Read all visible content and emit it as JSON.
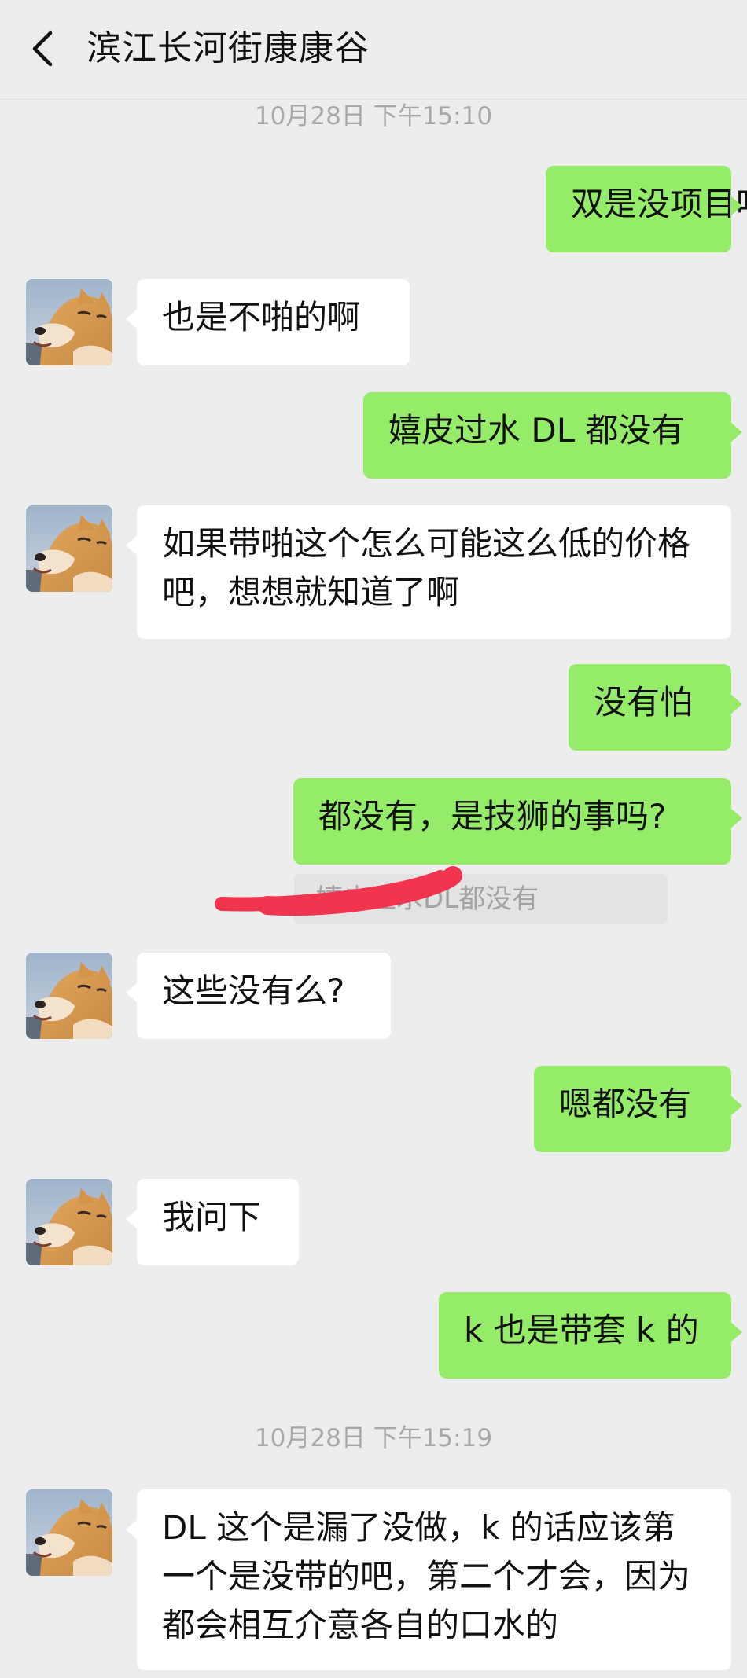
{
  "header": {
    "title": "滨江长河街康康谷"
  },
  "timestamps": [
    "10月28日 下午15:10",
    "10月28日 下午15:19"
  ],
  "messages": [
    {
      "side": "right",
      "text": "双是没项目吗"
    },
    {
      "side": "left",
      "text": "也是不啪的啊"
    },
    {
      "side": "right",
      "text": "嬉皮过水 DL 都没有"
    },
    {
      "side": "left",
      "text": "如果带啪这个怎么可能这么低的价格吧，想想就知道了啊"
    },
    {
      "side": "right",
      "text": "没有怕"
    },
    {
      "side": "right",
      "text": "都没有，是技狮的事吗?"
    },
    {
      "side": "left",
      "text": "这些没有么?"
    },
    {
      "side": "right",
      "text": "嗯都没有"
    },
    {
      "side": "left",
      "text": "我问下"
    },
    {
      "side": "right",
      "text": "k 也是带套 k 的"
    },
    {
      "side": "left",
      "text": "DL 这个是漏了没做，k 的话应该第一个是没带的吧，第二个才会，因为都会相互介意各自的口水的"
    }
  ],
  "quote": {
    "text": "嬉皮过水DL都没有"
  },
  "colors": {
    "background": "#ededed",
    "bubble_self": "#95ec69",
    "bubble_other": "#ffffff",
    "redaction": "#f2344f"
  },
  "icons": {
    "back": "chevron-left-icon",
    "avatar": "shiba-dog-avatar"
  }
}
